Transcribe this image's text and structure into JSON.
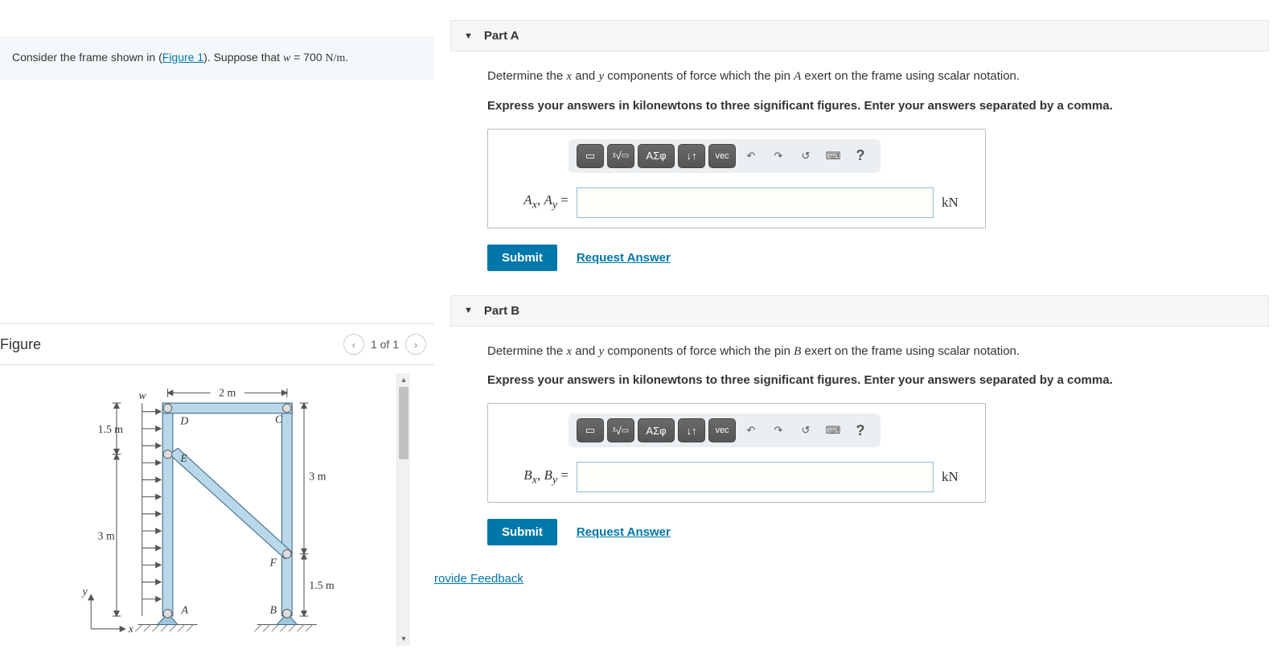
{
  "problem": {
    "prefix": "Consider the frame shown in (",
    "figure_link": "Figure 1",
    "middle": "). Suppose that ",
    "var": "w",
    "eq": " = 700 ",
    "unit": "N/m",
    "suffix": "."
  },
  "figure": {
    "title": "Figure",
    "counter": "1 of 1",
    "labels": {
      "w": "w",
      "top_span": "2 m",
      "left_top": "1.5 m",
      "left_bot": "3 m",
      "right_top": "3 m",
      "right_bot": "1.5 m",
      "A": "A",
      "B": "B",
      "C": "C",
      "D": "D",
      "E": "E",
      "F": "F",
      "x": "x",
      "y": "y"
    }
  },
  "partA": {
    "title": "Part A",
    "question_pre": "Determine the ",
    "x": "x",
    "and": " and ",
    "y": "y",
    "question_mid": " components of force which the pin ",
    "pin": "A",
    "question_post": " exert on the frame using scalar notation.",
    "instruction": "Express your answers in kilonewtons to three significant figures. Enter your answers separated by a comma.",
    "var_label": "Aₓ, A_y =",
    "var_html_x": "A",
    "var_html_xsub": "x",
    "var_html_sep": ", ",
    "var_html_y": "A",
    "var_html_ysub": "y",
    "var_eq": " =",
    "unit": "kN",
    "submit": "Submit",
    "request": "Request Answer"
  },
  "partB": {
    "title": "Part B",
    "question_pre": "Determine the ",
    "x": "x",
    "and": " and ",
    "y": "y",
    "question_mid": " components of force which the pin ",
    "pin": "B",
    "question_post": " exert on the frame using scalar notation.",
    "instruction": "Express your answers in kilonewtons to three significant figures. Enter your answers separated by a comma.",
    "var_html_x": "B",
    "var_html_xsub": "x",
    "var_html_sep": ", ",
    "var_html_y": "B",
    "var_html_ysub": "y",
    "var_eq": " =",
    "unit": "kN",
    "submit": "Submit",
    "request": "Request Answer"
  },
  "toolbar": {
    "templates": "▭",
    "sqrt": "√",
    "greek": "ΑΣφ",
    "subsup": "↓↑",
    "vec": "vec",
    "undo": "↶",
    "redo": "↷",
    "reset": "↺",
    "keyboard": "⌨",
    "help": "?"
  },
  "feedback": "Provide Feedback"
}
